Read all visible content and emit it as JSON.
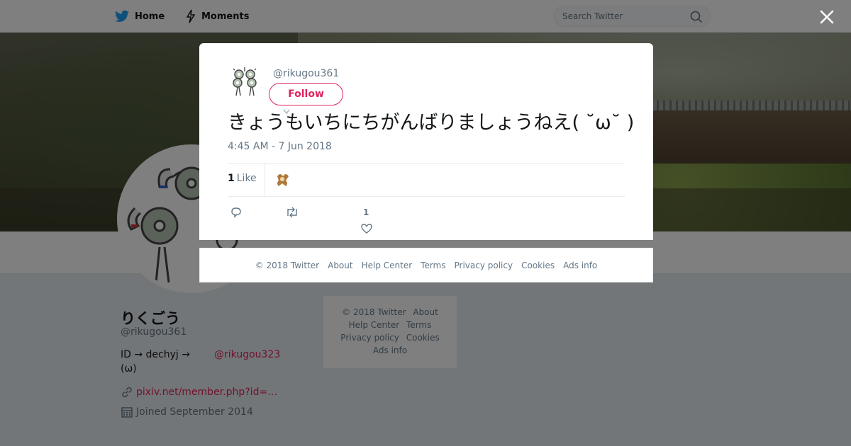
{
  "topbar": {
    "home_label": "Home",
    "moments_label": "Moments",
    "search_placeholder": "Search Twitter",
    "brand_color": "#1da1f2"
  },
  "profile": {
    "name": "りくごう",
    "handle": "@rikugou361",
    "bio_line1": "ID → dechyj  →",
    "bio_link": "@rikugou323",
    "bio_line2": "(ω)",
    "url": "pixiv.net/member.php?id=…",
    "joined": "Joined September 2014"
  },
  "side_footer": {
    "items": [
      "© 2018 Twitter",
      "About",
      "Help Center",
      "Terms",
      "Privacy policy",
      "Cookies",
      "Ads info"
    ]
  },
  "tweet": {
    "handle": "@rikugou361",
    "follow_label": "Follow",
    "text": "きょうもいちにちがんばりましょうねえ( ˘ω˘ )",
    "timestamp": "4:45 AM - 7 Jun 2018",
    "like_count": "1",
    "like_label": "Like",
    "action_like_count": "1",
    "accent_color": "#e0245e"
  },
  "modal_footer": {
    "items": [
      "© 2018 Twitter",
      "About",
      "Help Center",
      "Terms",
      "Privacy policy",
      "Cookies",
      "Ads info"
    ]
  }
}
